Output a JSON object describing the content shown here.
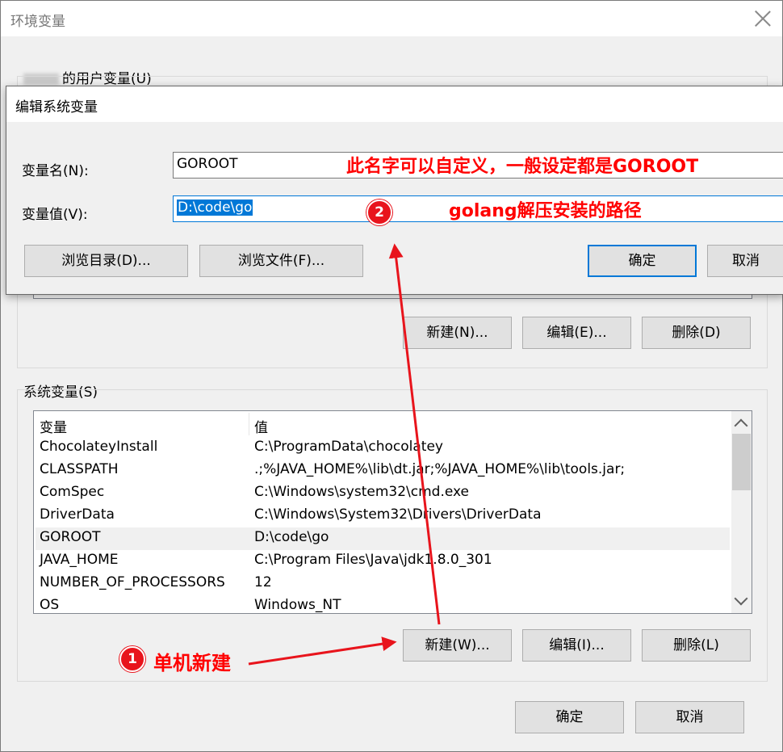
{
  "window": {
    "title": "环境变量",
    "user_group_label": "的用户变量(U)",
    "user_buttons": {
      "new": "新建(N)...",
      "edit": "编辑(E)...",
      "delete": "删除(D)"
    },
    "system_group_label": "系统变量(S)",
    "system_buttons": {
      "new": "新建(W)...",
      "edit": "编辑(I)...",
      "delete": "删除(L)"
    },
    "ok": "确定",
    "cancel": "取消"
  },
  "system_vars": {
    "headers": {
      "var": "变量",
      "val": "值"
    },
    "rows": [
      {
        "var": "ChocolateyInstall",
        "val": "C:\\ProgramData\\chocolatey"
      },
      {
        "var": "CLASSPATH",
        "val": ".;%JAVA_HOME%\\lib\\dt.jar;%JAVA_HOME%\\lib\\tools.jar;"
      },
      {
        "var": "ComSpec",
        "val": "C:\\Windows\\system32\\cmd.exe"
      },
      {
        "var": "DriverData",
        "val": "C:\\Windows\\System32\\Drivers\\DriverData"
      },
      {
        "var": "GOROOT",
        "val": "D:\\code\\go"
      },
      {
        "var": "JAVA_HOME",
        "val": "C:\\Program Files\\Java\\jdk1.8.0_301"
      },
      {
        "var": "NUMBER_OF_PROCESSORS",
        "val": "12"
      },
      {
        "var": "OS",
        "val": "Windows_NT"
      }
    ]
  },
  "edit_dialog": {
    "title": "编辑系统变量",
    "name_label": "变量名(N):",
    "name_value": "GOROOT",
    "value_label": "变量值(V):",
    "value_value": "D:\\code\\go",
    "browse_dir": "浏览目录(D)...",
    "browse_file": "浏览文件(F)...",
    "ok": "确定",
    "cancel": "取消"
  },
  "annotations": {
    "note_name": "此名字可以自定义，一般设定都是GOROOT",
    "note_value": "golang解压安装的路径",
    "step1_number": "1",
    "step1_text": "单机新建",
    "step2_number": "2",
    "color": "#ff0000"
  }
}
